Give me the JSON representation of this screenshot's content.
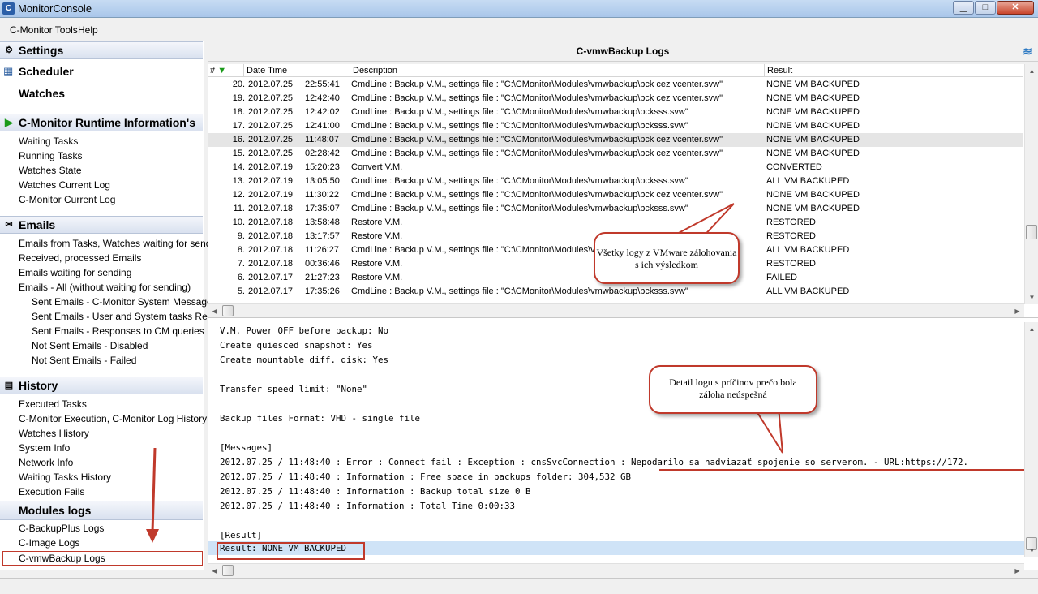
{
  "window": {
    "title": "MonitorConsole",
    "app_icon": "C",
    "controls": {
      "minimize": "▁",
      "maximize": "□",
      "close": "✕"
    }
  },
  "menu": {
    "items": [
      "C-Monitor Tools",
      "Help"
    ]
  },
  "sidebar": {
    "settings": "Settings",
    "scheduler": "Scheduler",
    "watches": "Watches",
    "runtime": {
      "title": "C-Monitor Runtime Information's",
      "items": [
        "Waiting Tasks",
        "Running Tasks",
        "Watches State",
        "Watches Current Log",
        "C-Monitor Current Log"
      ]
    },
    "emails": {
      "title": "Emails",
      "items": [
        "Emails from Tasks, Watches waiting for sending",
        "Received, processed Emails",
        "Emails waiting for sending",
        "Emails - All (without waiting for sending)"
      ],
      "subitems": [
        "Sent Emails - C-Monitor System Messages",
        "Sent Emails - User and System tasks Results",
        "Sent Emails - Responses to CM queries",
        "Not Sent Emails - Disabled",
        "Not Sent Emails - Failed"
      ]
    },
    "history": {
      "title": "History",
      "items": [
        "Executed Tasks",
        "C-Monitor Execution, C-Monitor Log History",
        "Watches History",
        "System Info",
        "Network Info",
        "Waiting Tasks History",
        "Execution Fails"
      ]
    },
    "modules": {
      "title": "Modules logs",
      "items": [
        "C-BackupPlus Logs",
        "C-Image Logs",
        "C-vmwBackup Logs"
      ]
    }
  },
  "main": {
    "title": "C-vmwBackup Logs",
    "columns": {
      "num": "#",
      "date": "Date Time",
      "desc": "Description",
      "result": "Result"
    },
    "rows": [
      {
        "num": "20.",
        "date": "2012.07.25",
        "time": "22:55:41",
        "desc": "CmdLine : Backup V.M., settings file : \"C:\\CMonitor\\Modules\\vmwbackup\\bck cez vcenter.svw\"",
        "result": "NONE VM BACKUPED"
      },
      {
        "num": "19.",
        "date": "2012.07.25",
        "time": "12:42:40",
        "desc": "CmdLine : Backup V.M., settings file : \"C:\\CMonitor\\Modules\\vmwbackup\\bck cez vcenter.svw\"",
        "result": "NONE VM BACKUPED"
      },
      {
        "num": "18.",
        "date": "2012.07.25",
        "time": "12:42:02",
        "desc": "CmdLine : Backup V.M., settings file : \"C:\\CMonitor\\Modules\\vmwbackup\\bcksss.svw\"",
        "result": "NONE VM BACKUPED"
      },
      {
        "num": "17.",
        "date": "2012.07.25",
        "time": "12:41:00",
        "desc": "CmdLine : Backup V.M., settings file : \"C:\\CMonitor\\Modules\\vmwbackup\\bcksss.svw\"",
        "result": "NONE VM BACKUPED"
      },
      {
        "num": "16.",
        "date": "2012.07.25",
        "time": "11:48:07",
        "desc": "CmdLine : Backup V.M., settings file : \"C:\\CMonitor\\Modules\\vmwbackup\\bck cez vcenter.svw\"",
        "result": "NONE VM BACKUPED"
      },
      {
        "num": "15.",
        "date": "2012.07.25",
        "time": "02:28:42",
        "desc": "CmdLine : Backup V.M., settings file : \"C:\\CMonitor\\Modules\\vmwbackup\\bck cez vcenter.svw\"",
        "result": "NONE VM BACKUPED"
      },
      {
        "num": "14.",
        "date": "2012.07.19",
        "time": "15:20:23",
        "desc": "Convert V.M.",
        "result": "CONVERTED"
      },
      {
        "num": "13.",
        "date": "2012.07.19",
        "time": "13:05:50",
        "desc": "CmdLine : Backup V.M., settings file : \"C:\\CMonitor\\Modules\\vmwbackup\\bcksss.svw\"",
        "result": "ALL VM BACKUPED"
      },
      {
        "num": "12.",
        "date": "2012.07.19",
        "time": "11:30:22",
        "desc": "CmdLine : Backup V.M., settings file : \"C:\\CMonitor\\Modules\\vmwbackup\\bck cez vcenter.svw\"",
        "result": "NONE VM BACKUPED"
      },
      {
        "num": "11.",
        "date": "2012.07.18",
        "time": "17:35:07",
        "desc": "CmdLine : Backup V.M., settings file : \"C:\\CMonitor\\Modules\\vmwbackup\\bcksss.svw\"",
        "result": "NONE VM BACKUPED"
      },
      {
        "num": "10.",
        "date": "2012.07.18",
        "time": "13:58:48",
        "desc": "Restore V.M.",
        "result": "RESTORED"
      },
      {
        "num": "9.",
        "date": "2012.07.18",
        "time": "13:17:57",
        "desc": "Restore V.M.",
        "result": "RESTORED"
      },
      {
        "num": "8.",
        "date": "2012.07.18",
        "time": "11:26:27",
        "desc": "CmdLine : Backup V.M., settings file : \"C:\\CMonitor\\Modules\\vmwbackup\\bcksss.svw\"",
        "result": "ALL VM BACKUPED"
      },
      {
        "num": "7.",
        "date": "2012.07.18",
        "time": "00:36:46",
        "desc": "Restore V.M.",
        "result": "RESTORED"
      },
      {
        "num": "6.",
        "date": "2012.07.17",
        "time": "21:27:23",
        "desc": "Restore V.M.",
        "result": "FAILED"
      },
      {
        "num": "5.",
        "date": "2012.07.17",
        "time": "17:35:26",
        "desc": "CmdLine : Backup V.M., settings file : \"C:\\CMonitor\\Modules\\vmwbackup\\bcksss.svw\"",
        "result": "ALL VM BACKUPED"
      }
    ],
    "selected_row": "16.",
    "detail_lines": [
      "V.M. Power OFF before backup: No",
      "Create quiesced snapshot: Yes",
      "Create mountable diff. disk: Yes",
      "",
      "Transfer speed limit: \"None\"",
      "",
      "Backup files Format: VHD - single file",
      "",
      "[Messages]",
      "2012.07.25 / 11:48:40 : Error : Connect fail : Exception : cnsSvcConnection : Nepodarilo sa nadviazať spojenie so serverom. - URL:https://172.",
      "2012.07.25 / 11:48:40 : Information : Free space in backups folder: 304,532 GB",
      "2012.07.25 / 11:48:40 : Information : Backup total size 0 B",
      "2012.07.25 / 11:48:40 : Information : Total Time 0:00:33",
      "",
      "[Result]",
      "Result: NONE VM BACKUPED"
    ]
  },
  "annotations": {
    "callout1": "Všetky logy z VMware zálohovania s ich výsledkom",
    "callout2": "Detail logu s príčinov prečo bola záloha neúspešná"
  },
  "colors": {
    "highlight": "#c0392b",
    "selected_detail": "#cfe3f7",
    "header_gradient": "#d9e1ef"
  }
}
